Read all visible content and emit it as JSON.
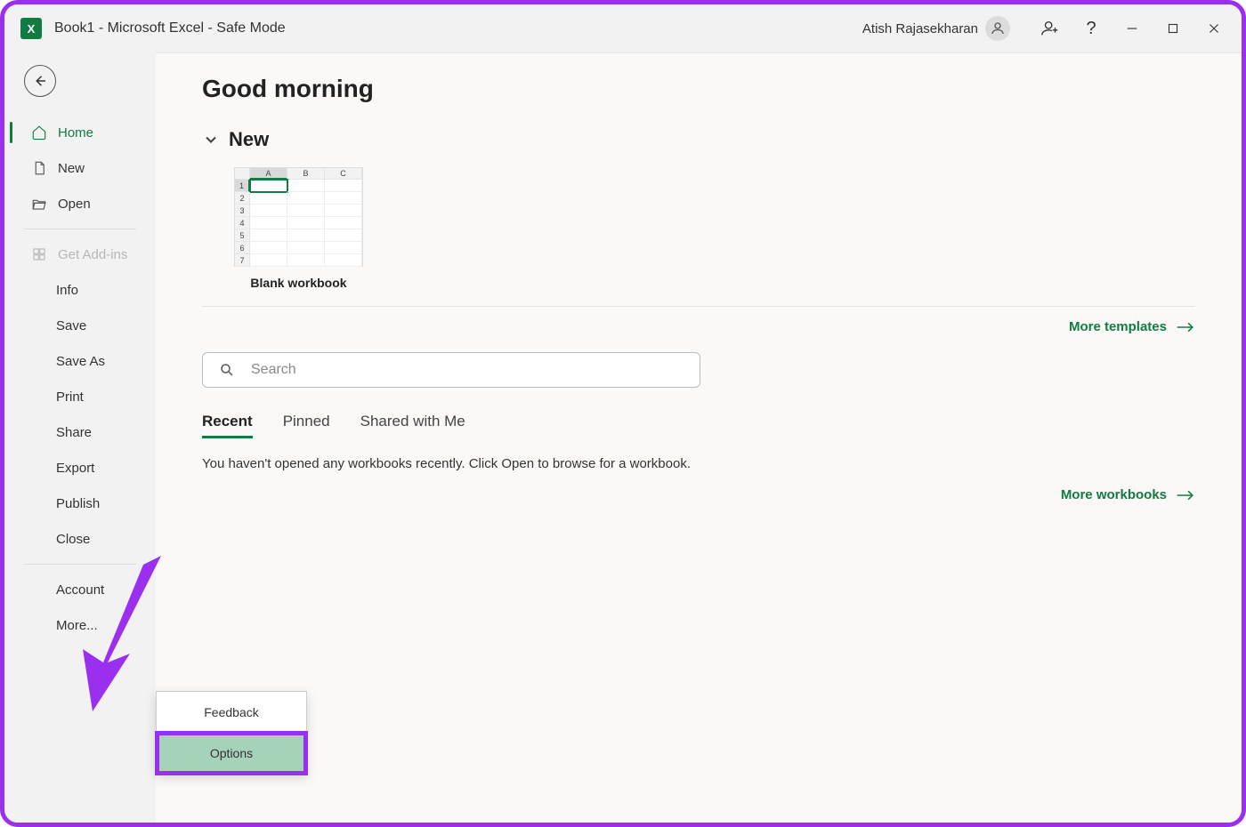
{
  "titlebar": {
    "document_title": "Book1  -  Microsoft Excel  -  Safe Mode",
    "user_name": "Atish Rajasekharan"
  },
  "sidebar": {
    "primary": [
      {
        "label": "Home",
        "icon": "home"
      },
      {
        "label": "New",
        "icon": "document"
      },
      {
        "label": "Open",
        "icon": "folder"
      }
    ],
    "addins_label": "Get Add-ins",
    "secondary": [
      {
        "label": "Info"
      },
      {
        "label": "Save"
      },
      {
        "label": "Save As"
      },
      {
        "label": "Print"
      },
      {
        "label": "Share"
      },
      {
        "label": "Export"
      },
      {
        "label": "Publish"
      },
      {
        "label": "Close"
      }
    ],
    "footer": [
      {
        "label": "Account"
      },
      {
        "label": "More..."
      }
    ]
  },
  "main": {
    "greeting": "Good morning",
    "new_section_label": "New",
    "blank_template_label": "Blank workbook",
    "more_templates_label": "More templates",
    "search_placeholder": "Search",
    "tabs": [
      {
        "label": "Recent"
      },
      {
        "label": "Pinned"
      },
      {
        "label": "Shared with Me"
      }
    ],
    "empty_state": "You haven't opened any workbooks recently. Click Open to browse for a workbook.",
    "more_workbooks_label": "More workbooks"
  },
  "popup": {
    "items": [
      {
        "label": "Feedback"
      },
      {
        "label": "Options"
      }
    ]
  },
  "colors": {
    "accent": "#107c41",
    "annotation": "#9b2ff0"
  }
}
